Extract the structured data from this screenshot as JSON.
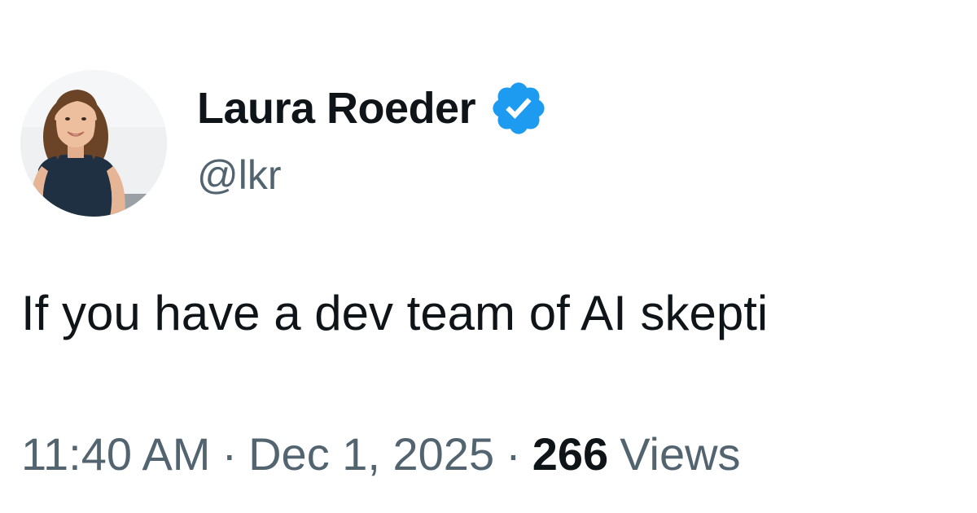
{
  "author": {
    "display_name": "Laura Roeder",
    "handle": "@lkr",
    "verified_icon": "verified-badge-icon",
    "badge_color": "#1d9bf0"
  },
  "tweet": {
    "text": "If you have a dev team of AI skepti",
    "time": "11:40 AM",
    "separator": "·",
    "date": "Dec 1, 2025",
    "views_count": "266",
    "views_label": "Views"
  },
  "colors": {
    "primary_text": "#0f1419",
    "secondary_text": "#536471",
    "background": "#ffffff"
  }
}
